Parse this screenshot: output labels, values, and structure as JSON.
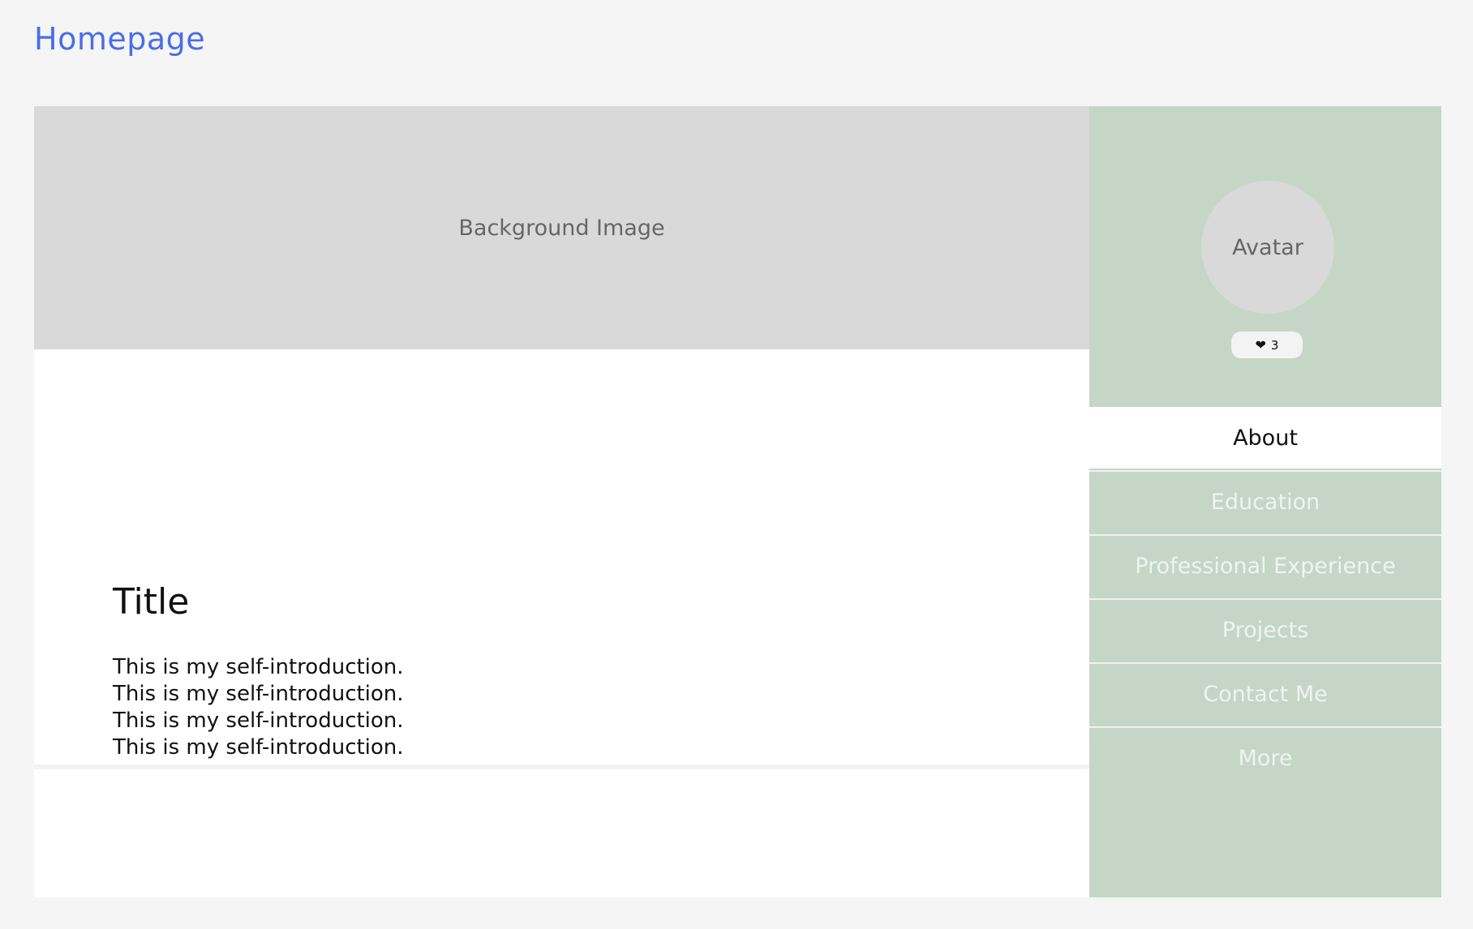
{
  "header": {
    "home_link": "Homepage"
  },
  "main": {
    "background_image_label": "Background Image",
    "title": "Title",
    "intro_lines": [
      "This is my self-introduction.",
      "This is my self-introduction.",
      "This is my self-introduction.",
      "This is my self-introduction."
    ]
  },
  "sidebar": {
    "avatar_label": "Avatar",
    "likes": {
      "icon": "heart-icon",
      "count": "3"
    },
    "nav": [
      {
        "label": "About",
        "active": true
      },
      {
        "label": "Education",
        "active": false
      },
      {
        "label": "Professional Experience",
        "active": false
      },
      {
        "label": "Projects",
        "active": false
      },
      {
        "label": "Contact Me",
        "active": false
      },
      {
        "label": "More",
        "active": false
      }
    ]
  },
  "colors": {
    "page_bg": "#f5f5f5",
    "link": "#4a6ee8",
    "sidebar_bg": "#c5d6c7",
    "placeholder_bg": "#d9d9d9"
  }
}
